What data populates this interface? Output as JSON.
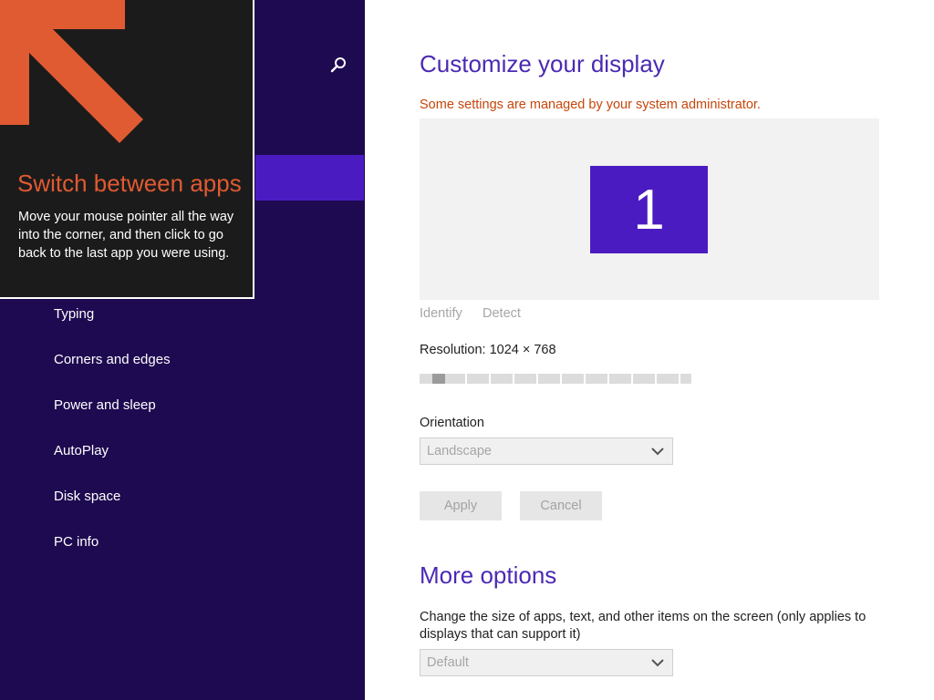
{
  "colors": {
    "sidebar_bg": "#1e0a50",
    "accent": "#4b1bc2",
    "heading": "#4b2ab3",
    "warning": "#c6460b",
    "tip_title": "#e05a32",
    "tip_arrow": "#e05a32"
  },
  "tip": {
    "arrow_icon": "arrow-up-left-icon",
    "title": "Switch between apps",
    "body": "Move your mouse pointer all the way into the corner, and then click to go back to the last app you were using."
  },
  "sidebar": {
    "search_icon": "search-icon",
    "items": [
      {
        "label": "Typing"
      },
      {
        "label": "Corners and edges"
      },
      {
        "label": "Power and sleep"
      },
      {
        "label": "AutoPlay"
      },
      {
        "label": "Disk space"
      },
      {
        "label": "PC info"
      }
    ]
  },
  "main": {
    "title": "Customize your display",
    "admin_note": "Some settings are managed by your system administrator.",
    "monitor_label": "1",
    "identify": "Identify",
    "detect": "Detect",
    "resolution_label": "Resolution: 1024 × 768",
    "resolution_position": 0.05,
    "orientation_label": "Orientation",
    "orientation_value": "Landscape",
    "apply": "Apply",
    "cancel": "Cancel",
    "more_options_title": "More options",
    "size_description": "Change the size of apps, text, and other items on the screen (only applies to displays that can support it)",
    "size_value": "Default"
  }
}
